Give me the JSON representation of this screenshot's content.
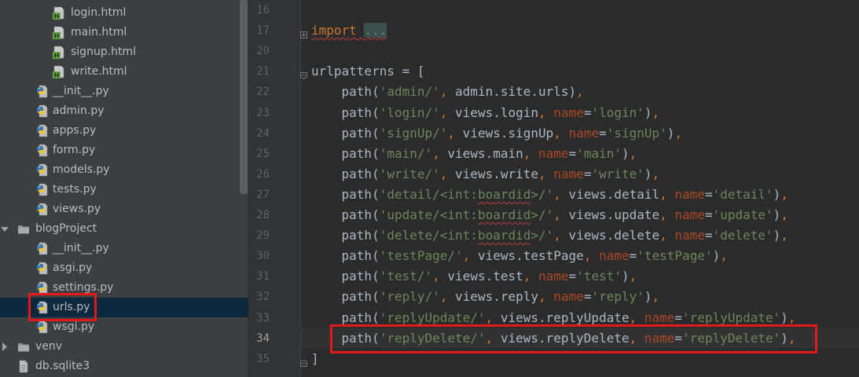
{
  "tree": {
    "items": [
      {
        "label": "login.html",
        "kind": "html"
      },
      {
        "label": "main.html",
        "kind": "html"
      },
      {
        "label": "signup.html",
        "kind": "html"
      },
      {
        "label": "write.html",
        "kind": "html"
      },
      {
        "label": "__init__.py",
        "kind": "py"
      },
      {
        "label": "admin.py",
        "kind": "py"
      },
      {
        "label": "apps.py",
        "kind": "py"
      },
      {
        "label": "form.py",
        "kind": "py"
      },
      {
        "label": "models.py",
        "kind": "py"
      },
      {
        "label": "tests.py",
        "kind": "py"
      },
      {
        "label": "views.py",
        "kind": "py"
      },
      {
        "label": "blogProject",
        "kind": "folder",
        "expanded": true
      },
      {
        "label": "__init__.py",
        "kind": "py"
      },
      {
        "label": "asgi.py",
        "kind": "py"
      },
      {
        "label": "settings.py",
        "kind": "py"
      },
      {
        "label": "urls.py",
        "kind": "py",
        "selected": true
      },
      {
        "label": "wsgi.py",
        "kind": "py"
      },
      {
        "label": "venv",
        "kind": "folder",
        "expanded": false
      },
      {
        "label": "db.sqlite3",
        "kind": "file"
      }
    ]
  },
  "editor": {
    "lines": [
      {
        "num": "16",
        "code": ""
      },
      {
        "num": "17",
        "code": "import ..."
      },
      {
        "num": "20",
        "code": ""
      },
      {
        "num": "21",
        "code": "urlpatterns = ["
      },
      {
        "num": "22",
        "code": "    path('admin/', admin.site.urls),"
      },
      {
        "num": "23",
        "code": "    path('login/', views.login, name='login'),"
      },
      {
        "num": "24",
        "code": "    path('signUp/', views.signUp, name='signUp'),"
      },
      {
        "num": "25",
        "code": "    path('main/', views.main, name='main'),"
      },
      {
        "num": "26",
        "code": "    path('write/', views.write, name='write'),"
      },
      {
        "num": "27",
        "code": "    path('detail/<int:boardid>/', views.detail, name='detail'),"
      },
      {
        "num": "28",
        "code": "    path('update/<int:boardid>/', views.update, name='update'),"
      },
      {
        "num": "29",
        "code": "    path('delete/<int:boardid>/', views.delete, name='delete'),"
      },
      {
        "num": "30",
        "code": "    path('testPage/', views.testPage, name='testPage'),"
      },
      {
        "num": "31",
        "code": "    path('test/', views.test, name='test'),"
      },
      {
        "num": "32",
        "code": "    path('reply/', views.reply, name='reply'),"
      },
      {
        "num": "33",
        "code": "    path('replyUpdate/', views.replyUpdate, name='replyUpdate'),"
      },
      {
        "num": "34",
        "code": "    path('replyDelete/', views.replyDelete, name='replyDelete'),",
        "current": true
      },
      {
        "num": "35",
        "code": "]"
      }
    ]
  },
  "colors": {
    "tree_bg": "#3c3f41",
    "editor_bg": "#2b2b2b",
    "gutter_bg": "#313335",
    "keyword": "#cc7832",
    "string": "#6a8759",
    "param": "#aa4926",
    "text": "#a9b7c6",
    "highlight_box": "#e51919",
    "selection": "#0d293e"
  },
  "icons": {
    "html": "html-file-icon",
    "py": "python-file-icon",
    "folder": "folder-icon",
    "file": "database-file-icon"
  }
}
